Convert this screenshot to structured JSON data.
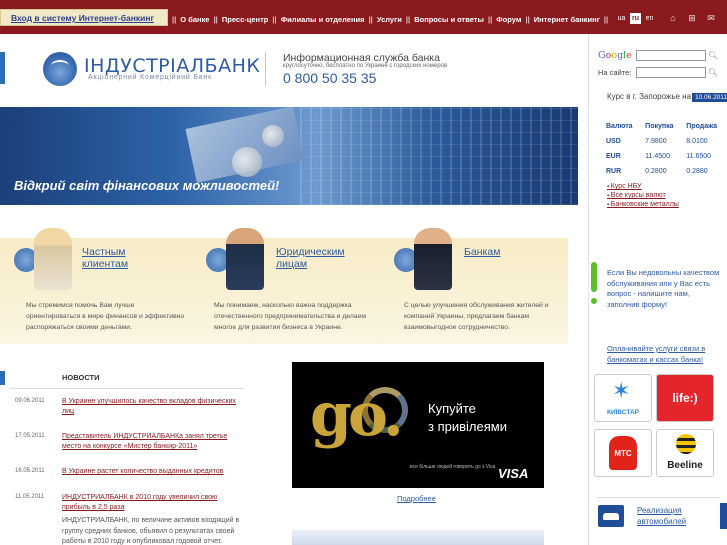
{
  "topbar": {
    "login_link": "Вход в систему Интернет-банкинг",
    "nav": [
      "О банке",
      "Пресс-центр",
      "Филиалы и отделения",
      "Услуги",
      "Вопросы и ответы",
      "Форум",
      "Интернет банкинг"
    ],
    "langs": [
      "ua",
      "ru",
      "en"
    ],
    "active_lang": "ru"
  },
  "header": {
    "logo_name": "ІНДУСТРІАЛБАНК",
    "logo_sub": "Акціонерний Комерційний Банк",
    "info_title": "Информационная служба банка",
    "info_sub": "круглосуточно, бесплатно по Украине с городских номеров",
    "phone": "0 800 50 35 35"
  },
  "search": {
    "google_label": "Google",
    "site_label": "На сайте:"
  },
  "rates": {
    "city_line": "Курс в г. Запорожье на",
    "date": "10.06.2011",
    "headers": [
      "Валюта",
      "Покупка",
      "Продажа"
    ],
    "rows": [
      [
        "USD",
        "7.9800",
        "8.0100"
      ],
      [
        "EUR",
        "11.4500",
        "11.6500"
      ],
      [
        "RUR",
        "0.2800",
        "0.2880"
      ]
    ],
    "links": [
      "Курс НБУ",
      "Все курсы валют",
      "Банковские металлы"
    ]
  },
  "banner": {
    "text": "Відкрий світ фінансових можливостей!"
  },
  "segments": [
    {
      "title_line1": "Частным",
      "title_line2": "клиентам",
      "desc": "Мы стремимся помочь Вам лучше ориентироваться в мире финансов и эффективно распоряжаться своими деньгами."
    },
    {
      "title_line1": "Юридическим",
      "title_line2": "лицам",
      "desc": "Мы понимаем, насколько важна поддержка отечественного предпринимательства и делаем многое для развития бизнеса в Украине."
    },
    {
      "title_line1": "Банкам",
      "title_line2": "",
      "desc": "С целью улучшения обслуживания жителей и компаний Украины, предлагаем банкам взаимовыгодное сотрудничество."
    }
  ],
  "news": {
    "heading": "НОВОСТИ",
    "items": [
      {
        "date": "09.06.2011",
        "title": "В Украине улучшилось качество вкладов физических лиц"
      },
      {
        "date": "17.05.2011",
        "title": "Представитель ИНДУСТРИАЛБАНКа занял третье место на конкурсе «Мистер банкир-2011»"
      },
      {
        "date": "16.05.2011",
        "title": "В Украине растет количество выданных кредитов"
      },
      {
        "date": "11.05.2011",
        "title": "ИНДУСТРИАЛБАНК в 2010 году увеличил свою прибыль в 2,5 раза"
      }
    ],
    "last_body": "ИНДУСТРИАЛБАНК, по величине активов входящий в группу средних банков, объявил о результатах своей работы в 2010 году и опубликовал годовой отчет."
  },
  "ad": {
    "go": "go.",
    "line1": "Купуйте",
    "line2": "з привілеями",
    "small": "все більше людей говорить go з Visa",
    "visa": "VISA",
    "more_link": "Подробнее"
  },
  "feedback": {
    "text": "Если Вы недовольны качеством обслуживания или у Вас есть вопрос - напишите нам, заполнив форму!"
  },
  "payments": {
    "text": "Оплачивайте услуги связи в банкоматах и кассах банка!",
    "operators": [
      "КИЇВСТАР",
      "life:)",
      "МТС",
      "Beeline"
    ]
  },
  "auto": {
    "line1": "Реализация",
    "line2": "автомобилей"
  },
  "colors": {
    "brand_red": "#8b1a1f",
    "brand_blue": "#2f5aa5",
    "accent_green": "#5cbf2a"
  }
}
